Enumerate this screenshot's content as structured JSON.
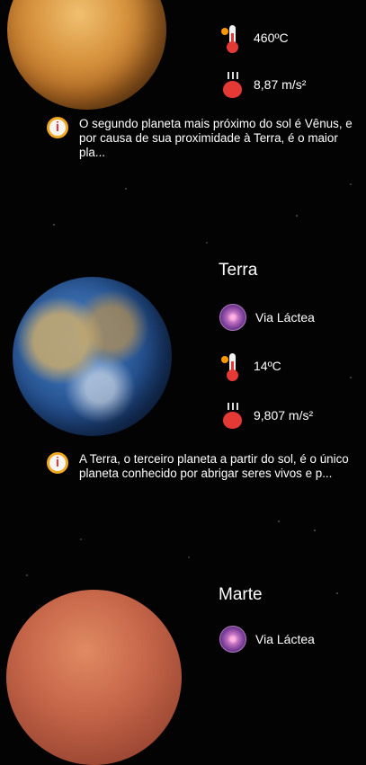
{
  "planets": [
    {
      "name": "",
      "temperature": "460ºC",
      "gravity": "8,87 m/s²",
      "description": "O segundo planeta mais próximo do sol é Vênus, e por causa de sua proximidade à Terra, é o maior pla..."
    },
    {
      "name": "Terra",
      "galaxy": "Via Láctea",
      "temperature": "14ºC",
      "gravity": "9,807 m/s²",
      "description": "A Terra, o terceiro planeta a partir do sol, é o único planeta conhecido por abrigar seres vivos e p..."
    },
    {
      "name": "Marte",
      "galaxy": "Via Láctea"
    }
  ],
  "icons": {
    "info": "i",
    "galaxy": "galaxy-icon",
    "temperature": "thermometer-icon",
    "gravity": "gravity-apple-icon"
  }
}
